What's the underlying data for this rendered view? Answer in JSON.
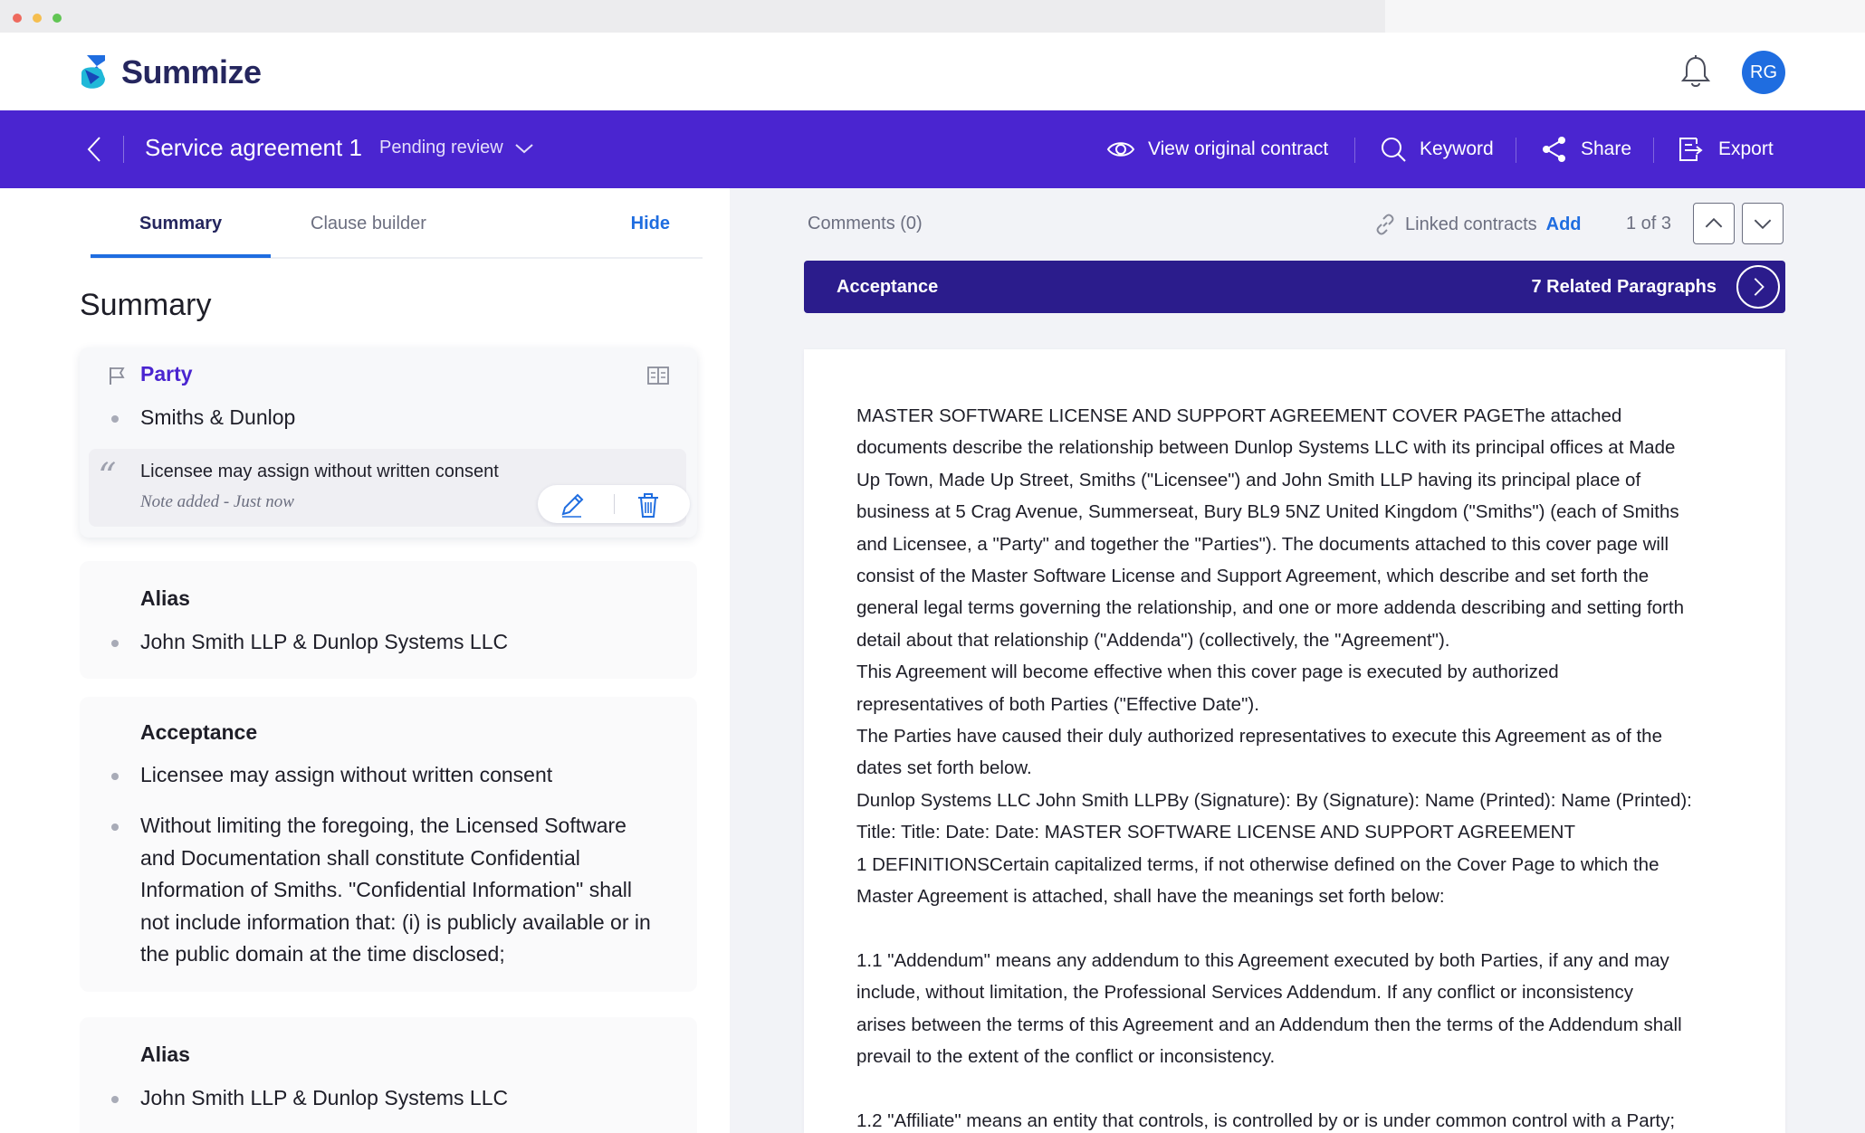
{
  "app": {
    "brand": "Summize",
    "avatar_initials": "RG"
  },
  "toolbar": {
    "title": "Service agreement 1",
    "status": "Pending review",
    "actions": {
      "view_original": "View original contract",
      "keyword": "Keyword",
      "share": "Share",
      "export": "Export"
    }
  },
  "tabs": {
    "summary": "Summary",
    "clause_builder": "Clause builder",
    "hide": "Hide"
  },
  "summary": {
    "heading": "Summary",
    "party": {
      "title": "Party",
      "items": [
        "Smiths  &  Dunlop"
      ],
      "note": {
        "text": "Licensee may assign without written consent",
        "meta": "Note added - Just now",
        "quote_mark": "“"
      }
    },
    "alias_1": {
      "title": "Alias",
      "items": [
        " John Smith LLP   &   Dunlop Systems LLC"
      ]
    },
    "acceptance": {
      "title": "Acceptance",
      "items": [
        "Licensee may assign without written consent",
        "Without limiting the foregoing, the Licensed Software and Documentation shall constitute Confidential Information of Smiths. \"Confidential Information\" shall not include information that: (i) is publicly available or in the public domain at the time disclosed;"
      ]
    },
    "alias_2": {
      "title": "Alias",
      "items": [
        " John Smith LLP   &   Dunlop Systems LLC"
      ]
    }
  },
  "document": {
    "comments": "Comments (0)",
    "linked_label": "Linked contracts",
    "linked_add": "Add",
    "pager": "1 of 3",
    "clause": "Acceptance",
    "related": "7 Related Paragraphs",
    "lines": [
      "MASTER SOFTWARE LICENSE AND SUPPORT AGREEMENT COVER PAGEThe attached",
      "documents describe the relationship between Dunlop Systems LLC with its principal offices at Made",
      "Up Town, Made Up Street, Smiths (\"Licensee\") and John Smith LLP having its principal place of",
      "business at 5 Crag Avenue, Summerseat, Bury BL9 5NZ United Kingdom (\"Smiths\") (each of Smiths",
      "and Licensee, a \"Party\" and together the \"Parties\"). The documents attached to this cover page will",
      "consist of the Master Software License and Support Agreement, which describe and set forth the",
      "general legal terms governing the relationship, and one or more addenda describing and setting forth",
      "detail about that relationship (\"Addenda\") (collectively, the \"Agreement\").",
      "This Agreement will become effective when this cover page is executed by authorized",
      "representatives of both Parties (\"Effective Date\").",
      "The Parties have caused their duly authorized representatives to execute this Agreement as of the",
      "dates set forth below.",
      "Dunlop Systems LLC John Smith LLPBy (Signature): By (Signature): Name (Printed): Name (Printed):",
      "Title: Title: Date: Date: MASTER SOFTWARE LICENSE AND SUPPORT AGREEMENT",
      "1 DEFINITIONSCertain capitalized terms, if not otherwise defined on the Cover Page to which the",
      "Master Agreement is attached, shall have the meanings set forth below:",
      "",
      "1.1 \"Addendum\" means any addendum to this Agreement executed by both Parties, if any and may",
      "include, without limitation, the Professional Services Addendum. If any conflict or inconsistency",
      "arises between the terms of this Agreement and an Addendum then the terms of the Addendum shall",
      "prevail to the extent of the conflict or inconsistency.",
      "",
      "1.2 \"Affiliate\" means an entity that controls, is controlled by or is under common control with a Party;"
    ]
  },
  "colors": {
    "toolbar": "#4a25d0",
    "clause_bar": "#2b1c8c",
    "accent": "#1f6de0",
    "brand_text": "#25265e"
  }
}
